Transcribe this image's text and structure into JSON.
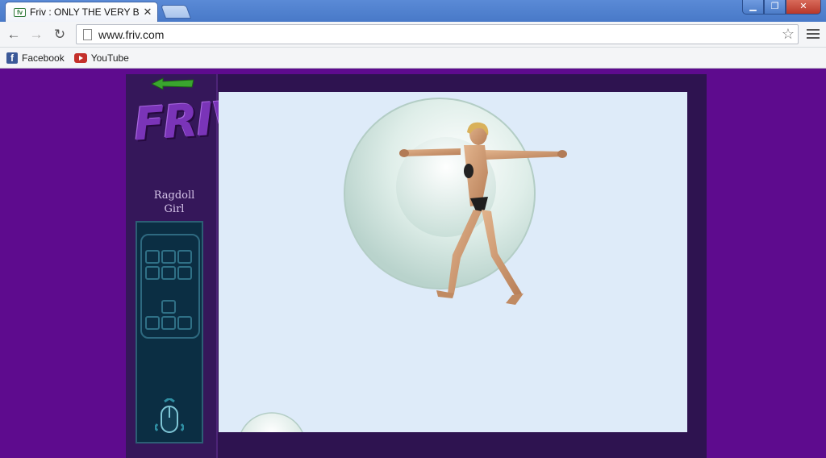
{
  "browser": {
    "tab_title": "Friv : ONLY THE VERY BES",
    "tab_favicon": "friv-icon",
    "url": "www.friv.com",
    "bookmarks": [
      {
        "label": "Facebook",
        "icon": "facebook-icon"
      },
      {
        "label": "YouTube",
        "icon": "youtube-icon"
      }
    ]
  },
  "sidebar": {
    "logo": "FRIV",
    "game_title_line1": "Ragdoll",
    "game_title_line2": "Girl"
  },
  "colors": {
    "page_background": "#5e0b8e",
    "frame": "#2e1350",
    "canvas": "#deebf9"
  }
}
